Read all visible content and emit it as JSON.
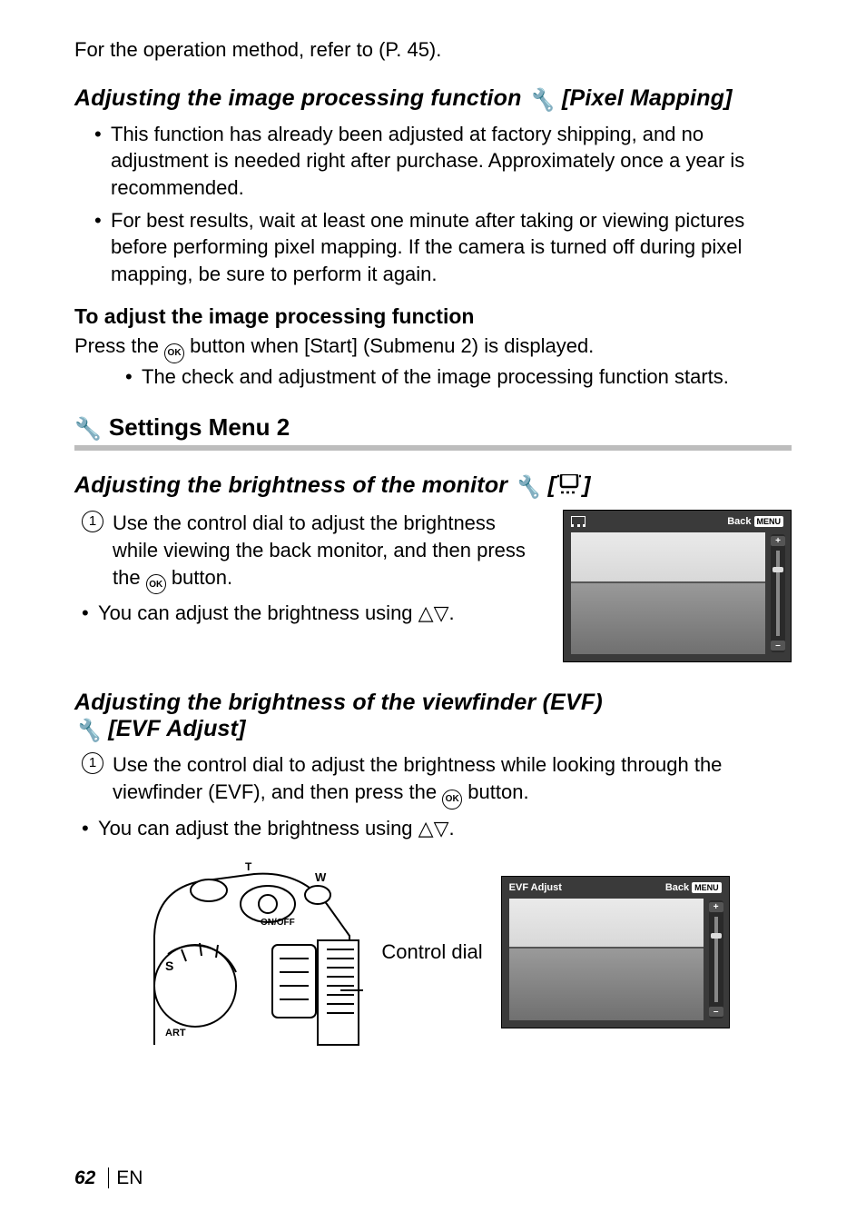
{
  "intro_line": "For the operation method, refer to (P. 45).",
  "section1": {
    "title_pre": "Adjusting the image processing function ",
    "title_post": " [Pixel Mapping]",
    "bullets": [
      "This function has already been adjusted at factory shipping, and no adjustment is needed right after purchase. Approximately once a year is recommended.",
      "For best results, wait at least one minute after taking or viewing pictures before performing pixel mapping. If the camera is turned off during pixel mapping, be sure to perform it again."
    ],
    "sub_heading": "To adjust the image processing function",
    "press_pre": "Press the ",
    "press_post": " button when [Start] (Submenu 2) is displayed.",
    "check_bullet": "The check and adjustment of the image processing function starts."
  },
  "menu_bar": " Settings Menu 2",
  "section2": {
    "title_pre": "Adjusting the brightness of the monitor ",
    "title_mid": " [",
    "title_post": "]",
    "step_pre": "Use the control dial to adjust the brightness while viewing the back monitor, and then press the ",
    "step_post": " button.",
    "note_pre": "You can adjust the brightness using ",
    "note_post": "."
  },
  "section3": {
    "title_line1": "Adjusting the brightness of the viewfinder (EVF)",
    "title_line2_post": " [EVF Adjust]",
    "step_pre": "Use the control dial to adjust the brightness while looking through the viewfinder (EVF), and then press the ",
    "step_post": " button.",
    "note_pre": "You can adjust the brightness using ",
    "note_post": ".",
    "dial_label": "Control dial"
  },
  "screen_brightness": {
    "back": "Back",
    "menu": "MENU",
    "plus": "+",
    "minus": "–"
  },
  "screen_evf": {
    "title": "EVF Adjust",
    "back": "Back",
    "menu": "MENU",
    "plus": "+",
    "minus": "–"
  },
  "camera_labels": {
    "on_off": "ON/OFF",
    "w": "W",
    "t": "T",
    "dial_s": "S",
    "dial_art": "ART"
  },
  "footer": {
    "page": "62",
    "lang": "EN"
  }
}
